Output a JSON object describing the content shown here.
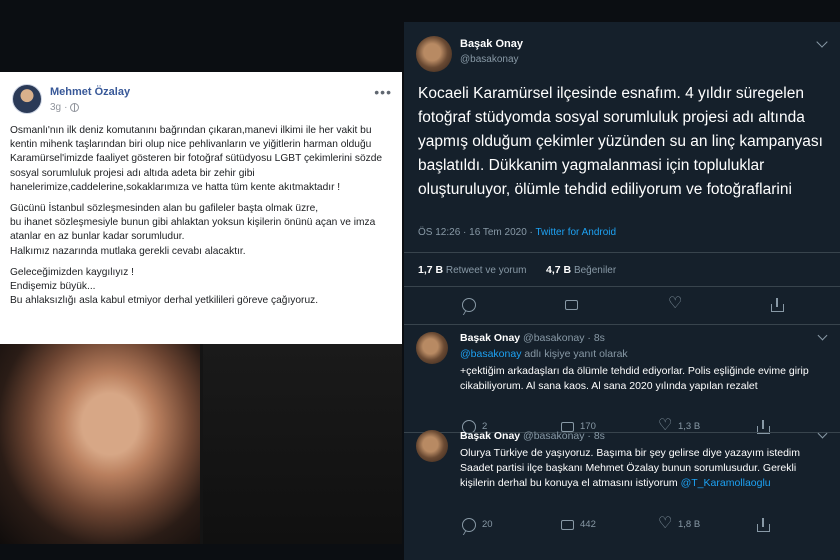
{
  "facebook": {
    "author": "Mehmet Özalay",
    "time": "3g",
    "more": "•••",
    "paragraphs": [
      "Osmanlı'nın ilk deniz komutanını bağrından çıkaran,manevi ilkimi ile her vakit bu kentin mihenk taşlarından biri olup nice pehlivanların ve yiğitlerin harman olduğu Karamürsel'imizde faaliyet gösteren bir fotoğraf sütüdyosu LGBT çekimlerini sözde sosyal sorumluluk projesi adı altıda adeta bir zehir gibi hanelerimize,caddelerine,sokaklarımıza ve hatta tüm kente akıtmaktadır !",
      "Gücünü İstanbul sözleşmesinden alan bu gafileler başta olmak üzre,\nbu ihanet sözleşmesiyle bunun gibi ahlaktan yoksun kişilerin önünü açan ve imza atanlar en az bunlar kadar sorumludur.\nHalkımız nazarında mutlaka gerekli cevabı alacaktır.",
      "Geleceğimizden kaygılıyız !\nEndişemiz büyük...\nBu ahlaksızlığı asla kabul etmiyor derhal yetkilileri göreve çağıyoruz."
    ]
  },
  "tweet": {
    "name": "Başak Onay",
    "handle": "@basakonay",
    "text": "Kocaeli Karamürsel ilçesinde esnafım. 4 yıldır süregelen fotoğraf stüdyomda sosyal sorumluluk projesi adı altında yapmış olduğum çekimler yüzünden su an linç kampanyası başlatıldı. Dükkanim yagmalanmasi için topluluklar oluşturuluyor, ölümle tehdid ediliyorum ve fotoğraflarini",
    "time": "ÖS 12:26 · 16 Tem 2020 · ",
    "source": "Twitter for Android",
    "retweets": "1,7 B",
    "retweets_label": "Retweet ve yorum",
    "likes": "4,7 B",
    "likes_label": "Beğeniler"
  },
  "replies": [
    {
      "name": "Başak Onay",
      "handle": "@basakonay",
      "time": "8s",
      "reply_to_mention": "@basakonay",
      "reply_to_suffix": " adlı kişiye yanıt olarak",
      "text": "+çektiğim arkadaşları da ölümle tehdid ediyorlar. Polis eşliğinde evime girip cikabiliyorum. Al sana kaos. Al sana 2020 yılında yapılan rezalet",
      "replies": "2",
      "retweets": "170",
      "likes": "1,3 B"
    },
    {
      "name": "Başak Onay",
      "handle": "@basakonay",
      "time": "8s",
      "text": "Olurya Türkiye de yaşıyoruz. Başıma bir şey gelirse diye yazayım istedim Saadet partisi ilçe başkanı Mehmet Özalay bunun sorumlusudur. Gerekli kişilerin derhal bu konuya el atmasını istiyorum ",
      "mention": "@T_Karamollaoglu",
      "replies": "20",
      "retweets": "442",
      "likes": "1,8 B"
    }
  ]
}
